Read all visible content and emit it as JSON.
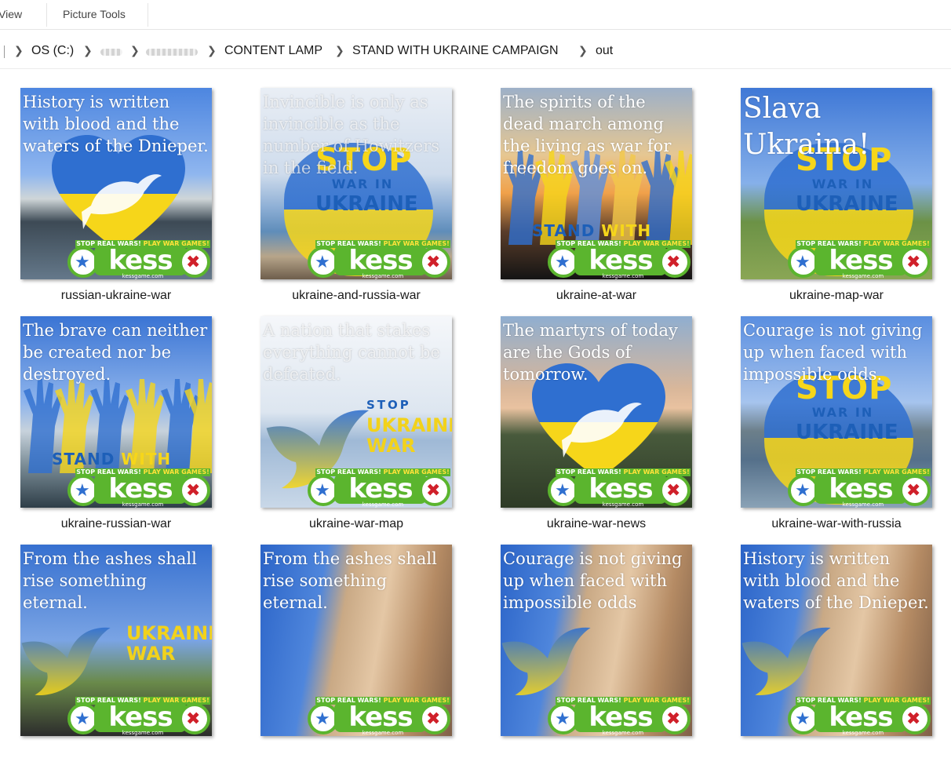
{
  "ribbon": {
    "view_tab": "View",
    "picture_tools_tab": "Picture Tools"
  },
  "breadcrumb": {
    "items": [
      "OS (C:)",
      "CONTENT LAMP",
      "STAND WITH UKRAINE CAMPAIGN",
      "out"
    ]
  },
  "badge": {
    "strip_left": "STOP REAL WARS!",
    "strip_right": "PLAY WAR GAMES!",
    "word": "kess",
    "site": "kessgame.com"
  },
  "files": [
    {
      "name": "russian-ukraine-war",
      "caption": "History is written with blood and the waters of the Dnieper.",
      "scene": "city-heart"
    },
    {
      "name": "ukraine-and-russia-war",
      "caption": "Invincible is only as invincible as the number of Howitzers in the field.",
      "scene": "sea-stop",
      "stop": [
        "STOP",
        "WAR IN",
        "UKRAINE"
      ]
    },
    {
      "name": "ukraine-at-war",
      "caption": "The spirits of the dead march among the living as war for freedom goes on.",
      "scene": "sunset-hands",
      "standwith": [
        "STAND",
        "WITH"
      ]
    },
    {
      "name": "ukraine-map-war",
      "caption": "Slava Ukraina!",
      "scene": "field-stop",
      "stop": [
        "STOP",
        "WAR IN",
        "UKRAINE"
      ]
    },
    {
      "name": "ukraine-russian-war",
      "caption": "The brave can neither be created nor be destroyed.",
      "scene": "building-hands",
      "standwith": [
        "STAND",
        "WITH"
      ]
    },
    {
      "name": "ukraine-war-map",
      "caption": "A nation that stakes everything cannot be defeated.",
      "scene": "sea-dove",
      "sideword": [
        "STOP",
        "UKRAINE",
        "WAR"
      ]
    },
    {
      "name": "ukraine-war-news",
      "caption": "The martyrs of today are the Gods of tomorrow.",
      "scene": "dusk-heart"
    },
    {
      "name": "ukraine-war-with-russia",
      "caption": "Courage is not giving up when faced with impossible odds.",
      "scene": "lake-stop",
      "stop": [
        "STOP",
        "WAR IN",
        "UKRAINE"
      ]
    },
    {
      "name": "",
      "caption": "From the ashes shall rise something eternal.",
      "scene": "spire-dove",
      "sideword": [
        "",
        "UKRAINE",
        "WAR"
      ]
    },
    {
      "name": "",
      "caption": "From the ashes shall rise something eternal.",
      "scene": "facade"
    },
    {
      "name": "",
      "caption": "Courage is not giving up when faced with impossible odds",
      "scene": "facade-dove"
    },
    {
      "name": "",
      "caption": "History is written with blood and the waters of the Dnieper.",
      "scene": "facade-dove"
    }
  ],
  "colors": {
    "ukraine_blue": "#2f6fd0",
    "ukraine_yellow": "#f6d61a",
    "kess_green": "#5bb52e",
    "kess_red": "#d0202a"
  }
}
